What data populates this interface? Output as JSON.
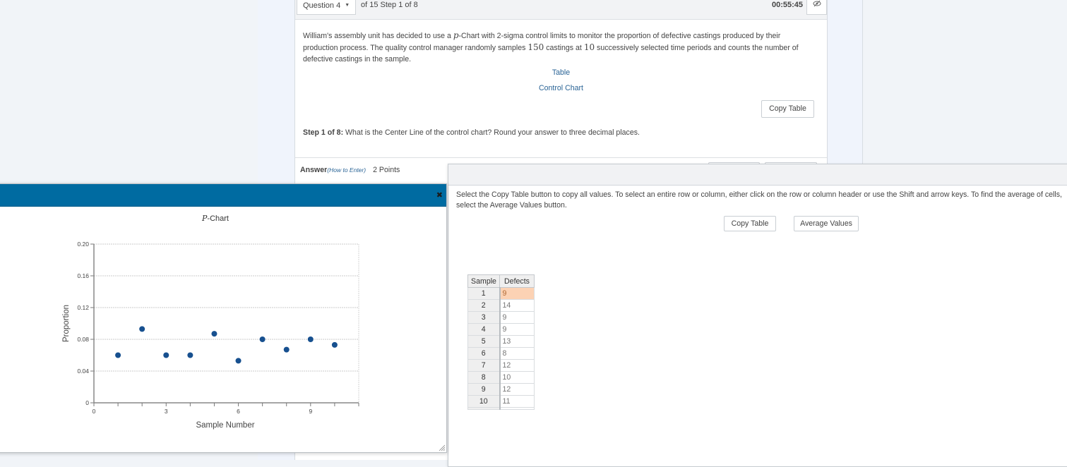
{
  "header": {
    "question_select": "Question 4",
    "of_text": "of 15 Step 1 of 8",
    "timer": "00:55:45",
    "eye_icon": "eye-slash-icon"
  },
  "question": {
    "text_part1": "William's assembly unit has decided to use a ",
    "text_p": "p",
    "text_part2": "-Chart with 2-sigma control limits to monitor the proportion of defective castings produced by their production process. The quality control manager randomly samples ",
    "sample_size": "150",
    "text_part3": " castings at ",
    "periods": "10",
    "text_part4": " successively selected time periods and counts the number of defective castings in the sample.",
    "link_table": "Table",
    "link_chart": "Control Chart",
    "copy_table": "Copy Table",
    "step_label": "Step 1 of 8:",
    "step_text": " What is the Center Line of the control chart? Round your answer to three decimal places.",
    "answer_label": "Answer",
    "how_to_enter": "(How to Enter)",
    "points": "2 Points"
  },
  "table_dialog": {
    "instructions": "Select the Copy Table button to copy all values. To select an entire row or column, either click on the row or column header or use the Shift and arrow keys. To find the average of cells, select the Average Values button.",
    "copy_table": "Copy Table",
    "average_values": "Average Values",
    "columns": [
      "Sample",
      "Defects"
    ],
    "rows": [
      [
        "1",
        "9"
      ],
      [
        "2",
        "14"
      ],
      [
        "3",
        "9"
      ],
      [
        "4",
        "9"
      ],
      [
        "5",
        "13"
      ],
      [
        "6",
        "8"
      ],
      [
        "7",
        "12"
      ],
      [
        "8",
        "10"
      ],
      [
        "9",
        "12"
      ],
      [
        "10",
        "11"
      ]
    ],
    "selected_cell": "Defects row 1",
    "selected_color": "#fcd2b4"
  },
  "chart_dialog": {
    "close_icon": "close-icon",
    "titlebar_color": "#006ba1"
  },
  "chart_data": {
    "type": "scatter",
    "title_italic": "P",
    "title_rest": "-Chart",
    "xlabel": "Sample Number",
    "ylabel": "Proportion",
    "xlim": [
      0,
      11
    ],
    "ylim": [
      0,
      0.2
    ],
    "xticks": [
      0,
      3,
      6,
      9
    ],
    "yticks": [
      0,
      0.04,
      0.08,
      0.12,
      0.16,
      0.2
    ],
    "ytick_labels": [
      "0",
      "0.04",
      "0.08",
      "0.12",
      "0.16",
      "0.20"
    ],
    "grid": true,
    "marker_color": "#17508f",
    "x": [
      1,
      2,
      3,
      4,
      5,
      6,
      7,
      8,
      9,
      10
    ],
    "y": [
      0.06,
      0.093,
      0.06,
      0.06,
      0.087,
      0.053,
      0.08,
      0.067,
      0.08,
      0.073
    ]
  }
}
